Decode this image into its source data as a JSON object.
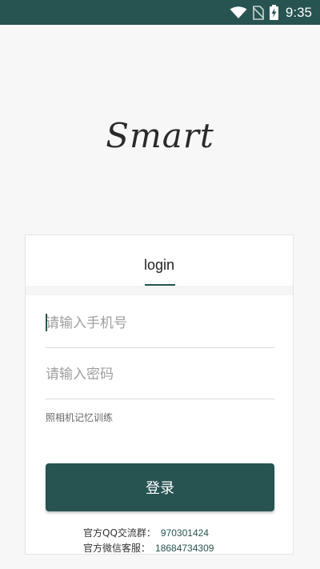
{
  "status_bar": {
    "time": "9:35",
    "background": "#275350",
    "icons": [
      "wifi-icon",
      "no-sim-icon",
      "battery-charging-icon"
    ]
  },
  "logo": {
    "text": "Smart"
  },
  "tabs": {
    "login_label": "login",
    "accent": "#275350"
  },
  "form": {
    "phone_placeholder": "请输入手机号",
    "phone_value": "",
    "password_placeholder": "请输入密码",
    "password_value": "",
    "memory_training_link": "照相机记忆训练",
    "login_button": "登录"
  },
  "contact": {
    "qq_label": "官方QQ交流群：",
    "qq_number": "970301424",
    "wechat_label": "官方微信客服：",
    "wechat_number": "18684734309"
  }
}
